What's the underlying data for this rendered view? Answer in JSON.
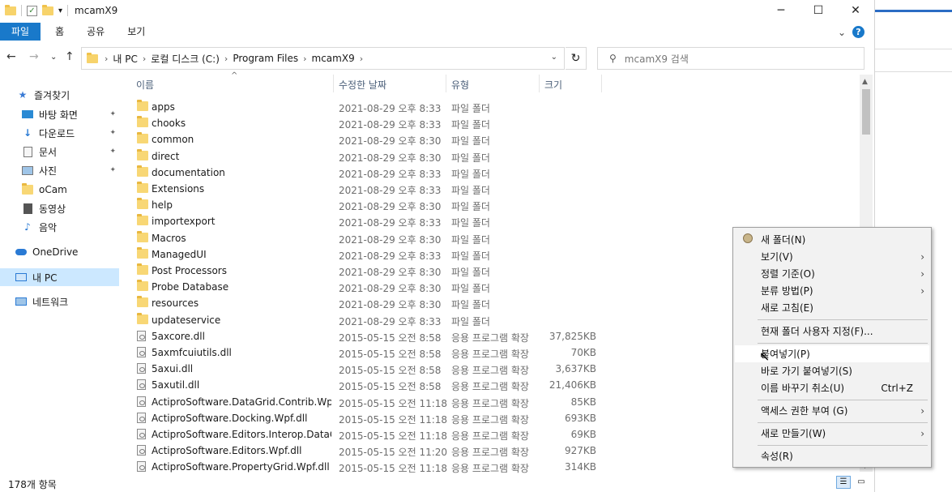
{
  "window": {
    "title": "mcamX9",
    "controls": {
      "minimize": "─",
      "maximize": "☐",
      "close": "✕"
    }
  },
  "ribbon": {
    "tabs": [
      {
        "label": "파일"
      },
      {
        "label": "홈"
      },
      {
        "label": "공유"
      },
      {
        "label": "보기"
      }
    ],
    "expand": "⌄",
    "help": "?"
  },
  "nav": {
    "back": "←",
    "forward": "→",
    "recent": "⌄",
    "up": "↑",
    "breadcrumbs": [
      "내 PC",
      "로컬 디스크 (C:)",
      "Program Files",
      "mcamX9"
    ],
    "crumb_sep": "›",
    "dropdown": "⌄",
    "refresh": "↻",
    "search_placeholder": "mcamX9 검색"
  },
  "sidebar": {
    "items": [
      {
        "label": "즐겨찾기",
        "icon": "star-icon"
      },
      {
        "label": "바탕 화면",
        "icon": "desktop-icon",
        "pinned": true
      },
      {
        "label": "다운로드",
        "icon": "download-icon",
        "pinned": true
      },
      {
        "label": "문서",
        "icon": "document-icon",
        "pinned": true
      },
      {
        "label": "사진",
        "icon": "picture-icon",
        "pinned": true
      },
      {
        "label": "oCam",
        "icon": "folder-icon"
      },
      {
        "label": "동영상",
        "icon": "video-icon"
      },
      {
        "label": "음악",
        "icon": "music-icon"
      },
      {
        "label": "OneDrive",
        "icon": "cloud-icon"
      },
      {
        "label": "내 PC",
        "icon": "computer-icon",
        "selected": true
      },
      {
        "label": "네트워크",
        "icon": "network-icon"
      }
    ],
    "pin_glyph": "📌"
  },
  "columns": {
    "name": "이름",
    "date": "수정한 날짜",
    "type": "유형",
    "size": "크기",
    "sort_glyph": "^"
  },
  "files": [
    {
      "name": "apps",
      "date": "2021-08-29 오후 8:33",
      "type": "파일 폴더",
      "size": "",
      "kind": "folder"
    },
    {
      "name": "chooks",
      "date": "2021-08-29 오후 8:33",
      "type": "파일 폴더",
      "size": "",
      "kind": "folder"
    },
    {
      "name": "common",
      "date": "2021-08-29 오후 8:30",
      "type": "파일 폴더",
      "size": "",
      "kind": "folder"
    },
    {
      "name": "direct",
      "date": "2021-08-29 오후 8:30",
      "type": "파일 폴더",
      "size": "",
      "kind": "folder"
    },
    {
      "name": "documentation",
      "date": "2021-08-29 오후 8:33",
      "type": "파일 폴더",
      "size": "",
      "kind": "folder"
    },
    {
      "name": "Extensions",
      "date": "2021-08-29 오후 8:33",
      "type": "파일 폴더",
      "size": "",
      "kind": "folder"
    },
    {
      "name": "help",
      "date": "2021-08-29 오후 8:30",
      "type": "파일 폴더",
      "size": "",
      "kind": "folder"
    },
    {
      "name": "importexport",
      "date": "2021-08-29 오후 8:33",
      "type": "파일 폴더",
      "size": "",
      "kind": "folder"
    },
    {
      "name": "Macros",
      "date": "2021-08-29 오후 8:30",
      "type": "파일 폴더",
      "size": "",
      "kind": "folder"
    },
    {
      "name": "ManagedUI",
      "date": "2021-08-29 오후 8:33",
      "type": "파일 폴더",
      "size": "",
      "kind": "folder"
    },
    {
      "name": "Post Processors",
      "date": "2021-08-29 오후 8:30",
      "type": "파일 폴더",
      "size": "",
      "kind": "folder"
    },
    {
      "name": "Probe Database",
      "date": "2021-08-29 오후 8:30",
      "type": "파일 폴더",
      "size": "",
      "kind": "folder"
    },
    {
      "name": "resources",
      "date": "2021-08-29 오후 8:30",
      "type": "파일 폴더",
      "size": "",
      "kind": "folder"
    },
    {
      "name": "updateservice",
      "date": "2021-08-29 오후 8:33",
      "type": "파일 폴더",
      "size": "",
      "kind": "folder"
    },
    {
      "name": "5axcore.dll",
      "date": "2015-05-15 오전 8:58",
      "type": "응용 프로그램 확장",
      "size": "37,825KB",
      "kind": "dll"
    },
    {
      "name": "5axmfcuiutils.dll",
      "date": "2015-05-15 오전 8:58",
      "type": "응용 프로그램 확장",
      "size": "70KB",
      "kind": "dll"
    },
    {
      "name": "5axui.dll",
      "date": "2015-05-15 오전 8:58",
      "type": "응용 프로그램 확장",
      "size": "3,637KB",
      "kind": "dll"
    },
    {
      "name": "5axutil.dll",
      "date": "2015-05-15 오전 8:58",
      "type": "응용 프로그램 확장",
      "size": "21,406KB",
      "kind": "dll"
    },
    {
      "name": "ActiproSoftware.DataGrid.Contrib.Wpf.dll",
      "date": "2015-05-15 오전 11:18",
      "type": "응용 프로그램 확장",
      "size": "85KB",
      "kind": "dll"
    },
    {
      "name": "ActiproSoftware.Docking.Wpf.dll",
      "date": "2015-05-15 오전 11:18",
      "type": "응용 프로그램 확장",
      "size": "693KB",
      "kind": "dll"
    },
    {
      "name": "ActiproSoftware.Editors.Interop.DataGrid...",
      "date": "2015-05-15 오전 11:18",
      "type": "응용 프로그램 확장",
      "size": "69KB",
      "kind": "dll"
    },
    {
      "name": "ActiproSoftware.Editors.Wpf.dll",
      "date": "2015-05-15 오전 11:20",
      "type": "응용 프로그램 확장",
      "size": "927KB",
      "kind": "dll"
    },
    {
      "name": "ActiproSoftware.PropertyGrid.Wpf.dll",
      "date": "2015-05-15 오전 11:18",
      "type": "응용 프로그램 확장",
      "size": "314KB",
      "kind": "dll"
    }
  ],
  "status": {
    "count": "178개 항목"
  },
  "context_menu": {
    "items": [
      {
        "label": "새 폴더(N)",
        "submenu": false
      },
      {
        "label": "보기(V)",
        "submenu": true
      },
      {
        "label": "정렬 기준(O)",
        "submenu": true
      },
      {
        "label": "분류 방법(P)",
        "submenu": true
      },
      {
        "label": "새로 고침(E)",
        "submenu": false
      },
      {
        "label": "현재 폴더 사용자 지정(F)...",
        "submenu": false
      },
      {
        "label": "붙여넣기(P)",
        "submenu": false,
        "highlighted": true
      },
      {
        "label": "바로 가기 붙여넣기(S)",
        "submenu": false
      },
      {
        "label": "이름 바꾸기 취소(U)",
        "submenu": false,
        "shortcut": "Ctrl+Z"
      },
      {
        "label": "액세스 권한 부여 (G)",
        "submenu": true
      },
      {
        "label": "새로 만들기(W)",
        "submenu": true
      },
      {
        "label": "속성(R)",
        "submenu": false
      }
    ],
    "submenu_glyph": "›"
  },
  "colors": {
    "accent": "#1979ca",
    "selected": "#cce8ff",
    "folder": "#f8d775"
  }
}
